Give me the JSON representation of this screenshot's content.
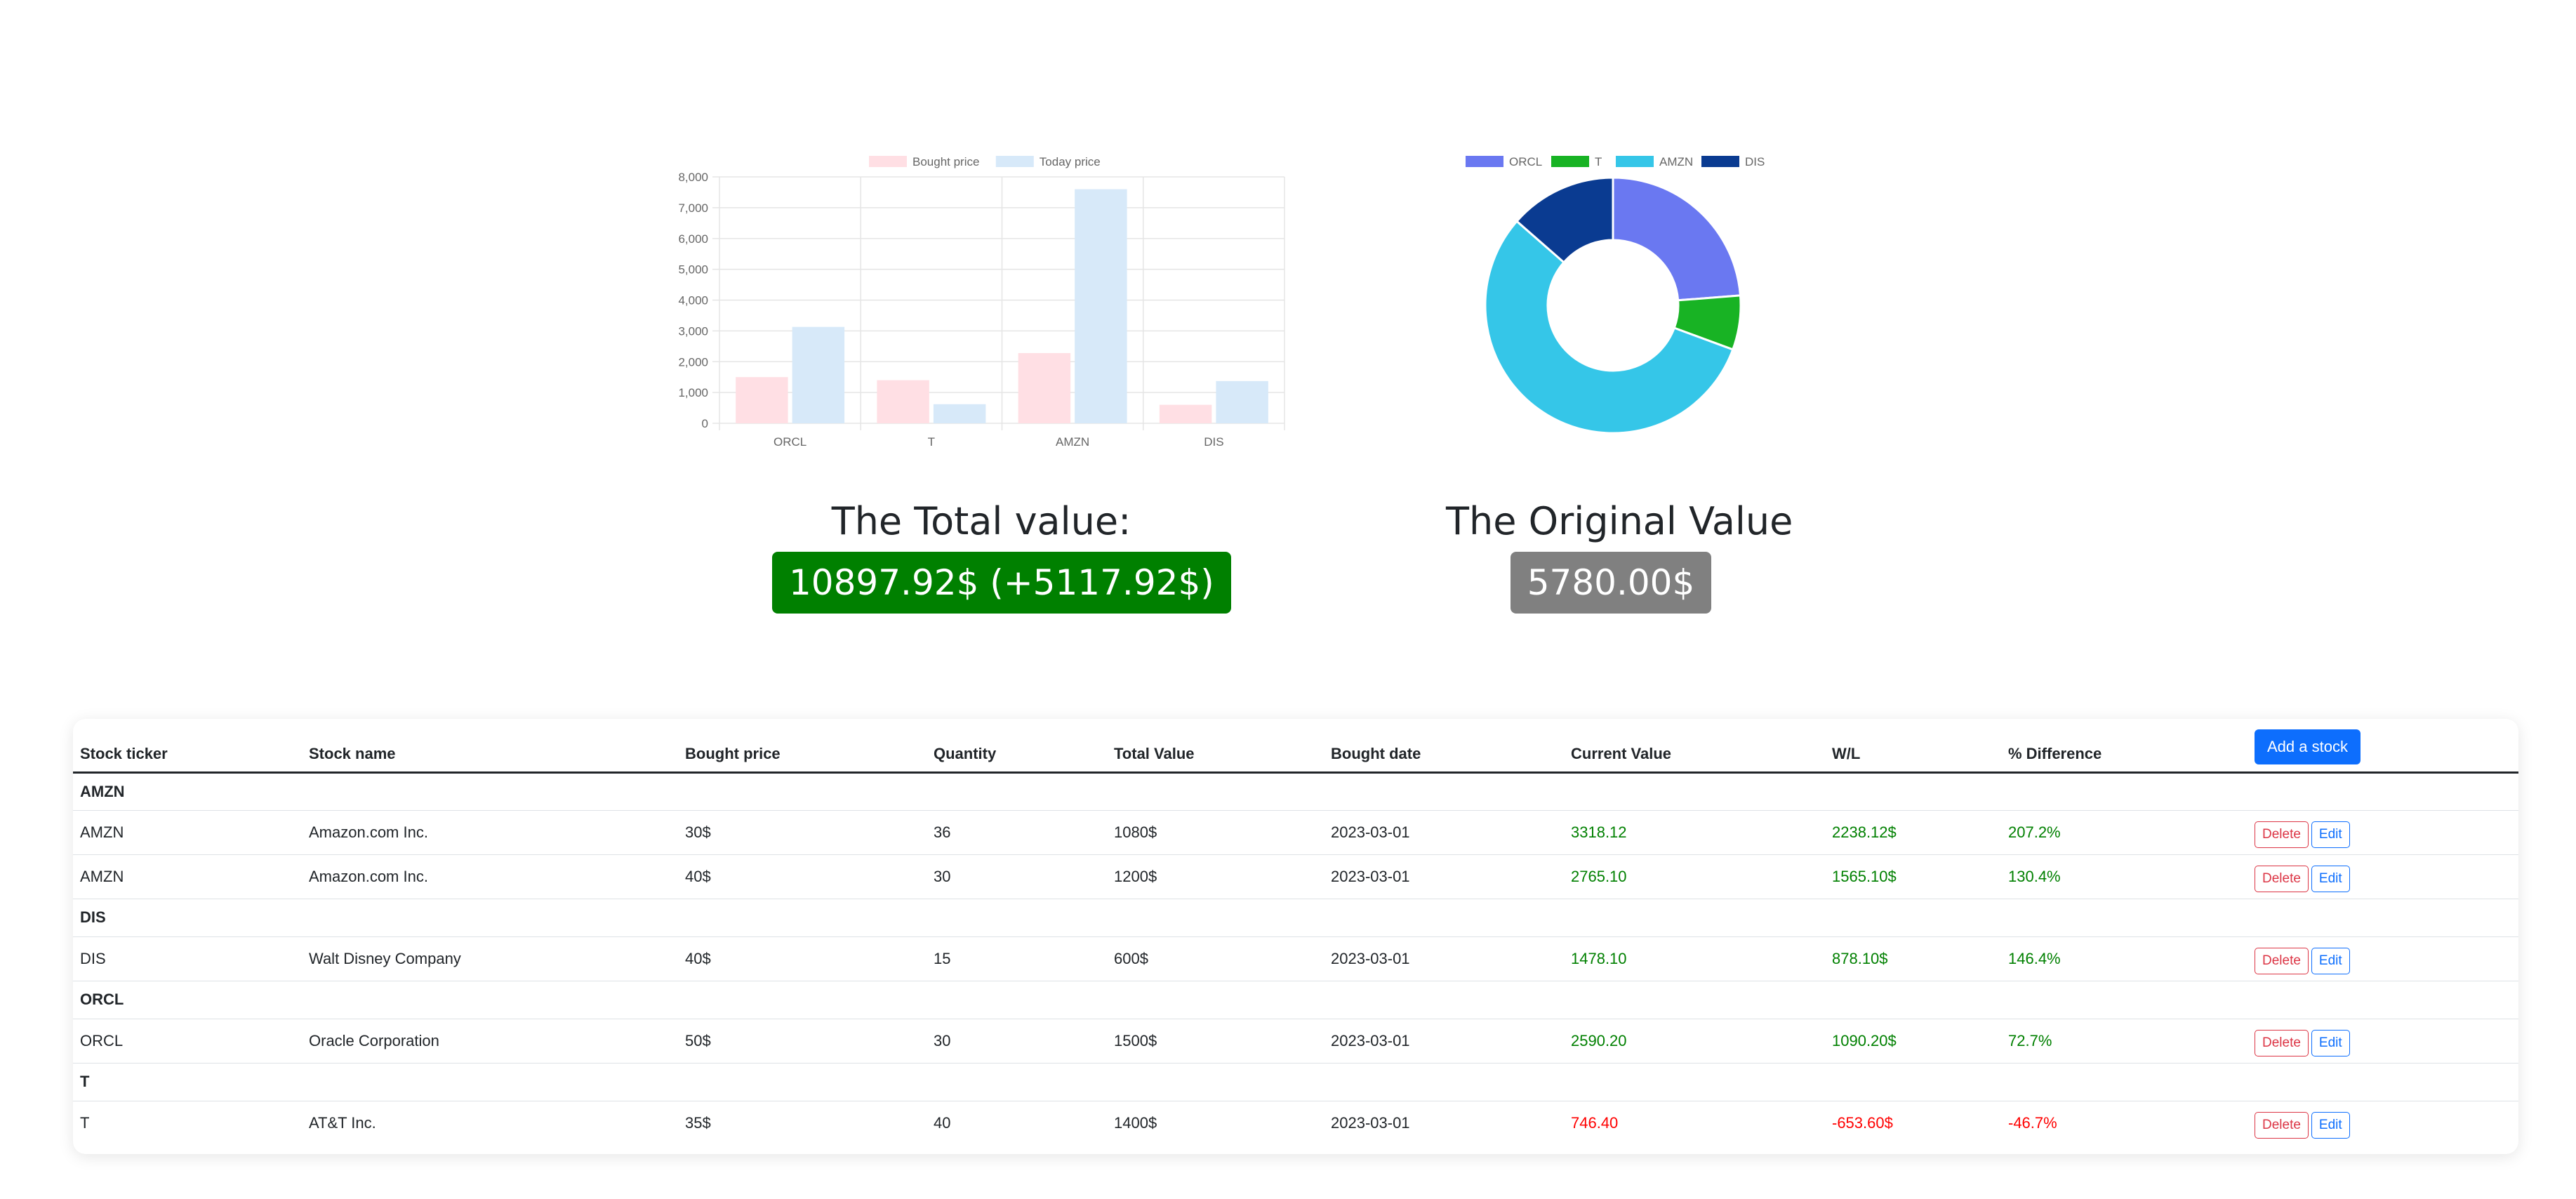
{
  "colors": {
    "positive": "#008000",
    "negative": "#ff0000",
    "accent": "#0d6efd",
    "total_badge": "#008000",
    "original_badge": "#808080"
  },
  "chart_data": [
    {
      "type": "bar",
      "categories": [
        "ORCL",
        "T",
        "AMZN",
        "DIS"
      ],
      "series": [
        {
          "name": "Bought price",
          "values": [
            1500,
            1400,
            2280,
            600
          ],
          "color": "#ffdfe4"
        },
        {
          "name": "Today price",
          "values": [
            3130,
            620,
            7600,
            1370
          ],
          "color": "#d7e9f9"
        }
      ],
      "ylim": [
        0,
        8000
      ],
      "yticks": [
        "0",
        "1,000",
        "2,000",
        "3,000",
        "4,000",
        "5,000",
        "6,000",
        "7,000",
        "8,000"
      ],
      "grid": true,
      "legend_position": "top"
    },
    {
      "type": "pie",
      "donut": true,
      "labels": [
        "ORCL",
        "T",
        "AMZN",
        "DIS"
      ],
      "values": [
        2590.2,
        746.4,
        6083.22,
        1478.1
      ],
      "colors": [
        "#6a78f1",
        "#18b324",
        "#35c6e8",
        "#0a3b91"
      ],
      "legend_position": "top"
    }
  ],
  "summary": {
    "total_heading": "The Total value:",
    "total_badge": "10897.92$ (+5117.92$)",
    "original_heading": "The Original Value",
    "original_badge": "5780.00$"
  },
  "table": {
    "headers": [
      "Stock ticker",
      "Stock name",
      "Bought price",
      "Quantity",
      "Total Value",
      "Bought date",
      "Current Value",
      "W/L",
      "% Difference"
    ],
    "add_button": "Add a stock",
    "delete_label": "Delete",
    "edit_label": "Edit",
    "groups": [
      {
        "ticker": "AMZN",
        "rows": [
          {
            "ticker": "AMZN",
            "name": "Amazon.com Inc.",
            "bought_price": "30$",
            "quantity": "36",
            "total_value": "1080$",
            "date": "2023-03-01",
            "current_value": "3318.12",
            "wl": "2238.12$",
            "pct": "207.2%",
            "positive": true
          },
          {
            "ticker": "AMZN",
            "name": "Amazon.com Inc.",
            "bought_price": "40$",
            "quantity": "30",
            "total_value": "1200$",
            "date": "2023-03-01",
            "current_value": "2765.10",
            "wl": "1565.10$",
            "pct": "130.4%",
            "positive": true
          }
        ]
      },
      {
        "ticker": "DIS",
        "rows": [
          {
            "ticker": "DIS",
            "name": "Walt Disney Company",
            "bought_price": "40$",
            "quantity": "15",
            "total_value": "600$",
            "date": "2023-03-01",
            "current_value": "1478.10",
            "wl": "878.10$",
            "pct": "146.4%",
            "positive": true
          }
        ]
      },
      {
        "ticker": "ORCL",
        "rows": [
          {
            "ticker": "ORCL",
            "name": "Oracle Corporation",
            "bought_price": "50$",
            "quantity": "30",
            "total_value": "1500$",
            "date": "2023-03-01",
            "current_value": "2590.20",
            "wl": "1090.20$",
            "pct": "72.7%",
            "positive": true
          }
        ]
      },
      {
        "ticker": "T",
        "rows": [
          {
            "ticker": "T",
            "name": "AT&T Inc.",
            "bought_price": "35$",
            "quantity": "40",
            "total_value": "1400$",
            "date": "2023-03-01",
            "current_value": "746.40",
            "wl": "-653.60$",
            "pct": "-46.7%",
            "positive": false
          }
        ]
      }
    ]
  }
}
